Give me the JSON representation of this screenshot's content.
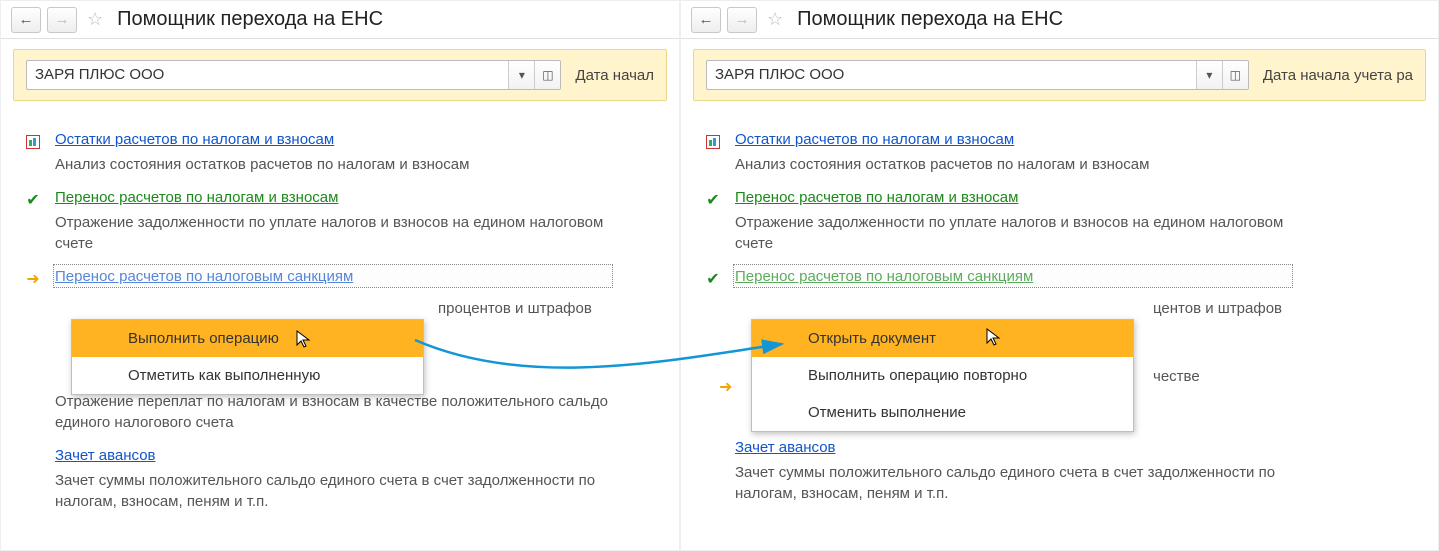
{
  "page_title": "Помощник перехода на ЕНС",
  "org_value": "ЗАРЯ ПЛЮС ООО",
  "date_label_short": "Дата начал",
  "date_label_long": "Дата начала учета ра",
  "steps": {
    "s1_title": "Остатки расчетов по налогам и взносам",
    "s1_desc": "Анализ состояния остатков расчетов по налогам и взносам",
    "s2_title": "Перенос расчетов по налогам и взносам",
    "s2_desc": "Отражение задолженности по уплате налогов и взносов на едином налоговом счете",
    "s3_title": "Перенос расчетов по налоговым санкциям",
    "s3_desc_trail_left": "процентов и штрафов",
    "s3_desc_trail_right": "центов и штрафов",
    "s3_desc_trail_right2": "честве",
    "s4_desc": "Отражение переплат по налогам и взносам в качестве положительного сальдо единого налогового счета",
    "s5_title": "Зачет авансов",
    "s5_desc": "Зачет суммы положительного сальдо единого счета в счет задолженности по налогам, взносам, пеням и т.п."
  },
  "menu_left": {
    "item1": "Выполнить операцию",
    "item2": "Отметить как выполненную"
  },
  "menu_right": {
    "item1": "Открыть документ",
    "item2": "Выполнить операцию повторно",
    "item3": "Отменить выполнение"
  },
  "icons": {
    "back": "←",
    "forward": "→",
    "star": "☆",
    "dropdown": "▾",
    "popout": "◫",
    "check": "✔",
    "arrow_current": "➜"
  }
}
